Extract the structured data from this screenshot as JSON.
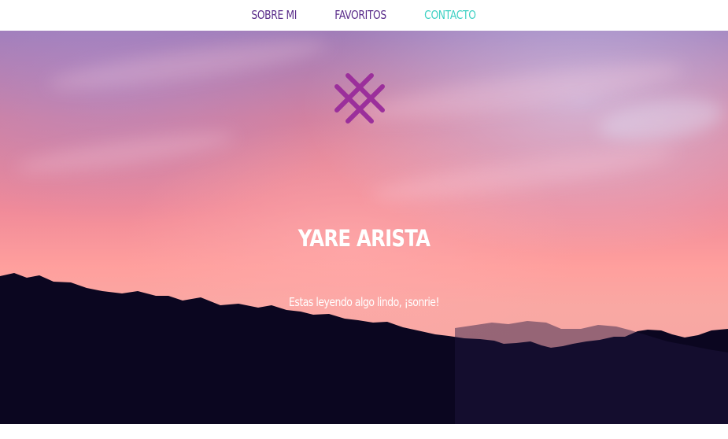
{
  "nav": {
    "items": [
      {
        "label": "SOBRE MI",
        "color": "#5a2c8a"
      },
      {
        "label": "FAVORITOS",
        "color": "#5a2c8a"
      },
      {
        "label": "CONTACTO",
        "color": "#3fd1c4"
      }
    ]
  },
  "hero": {
    "title": "YARE ARISTA",
    "subtitle": "Estas leyendo algo lindo, ¡sonrie!",
    "logo_icon": "crossed-lines-logo-icon",
    "logo_color": "#9b2f9b",
    "mountain_color": "#0b0620"
  }
}
